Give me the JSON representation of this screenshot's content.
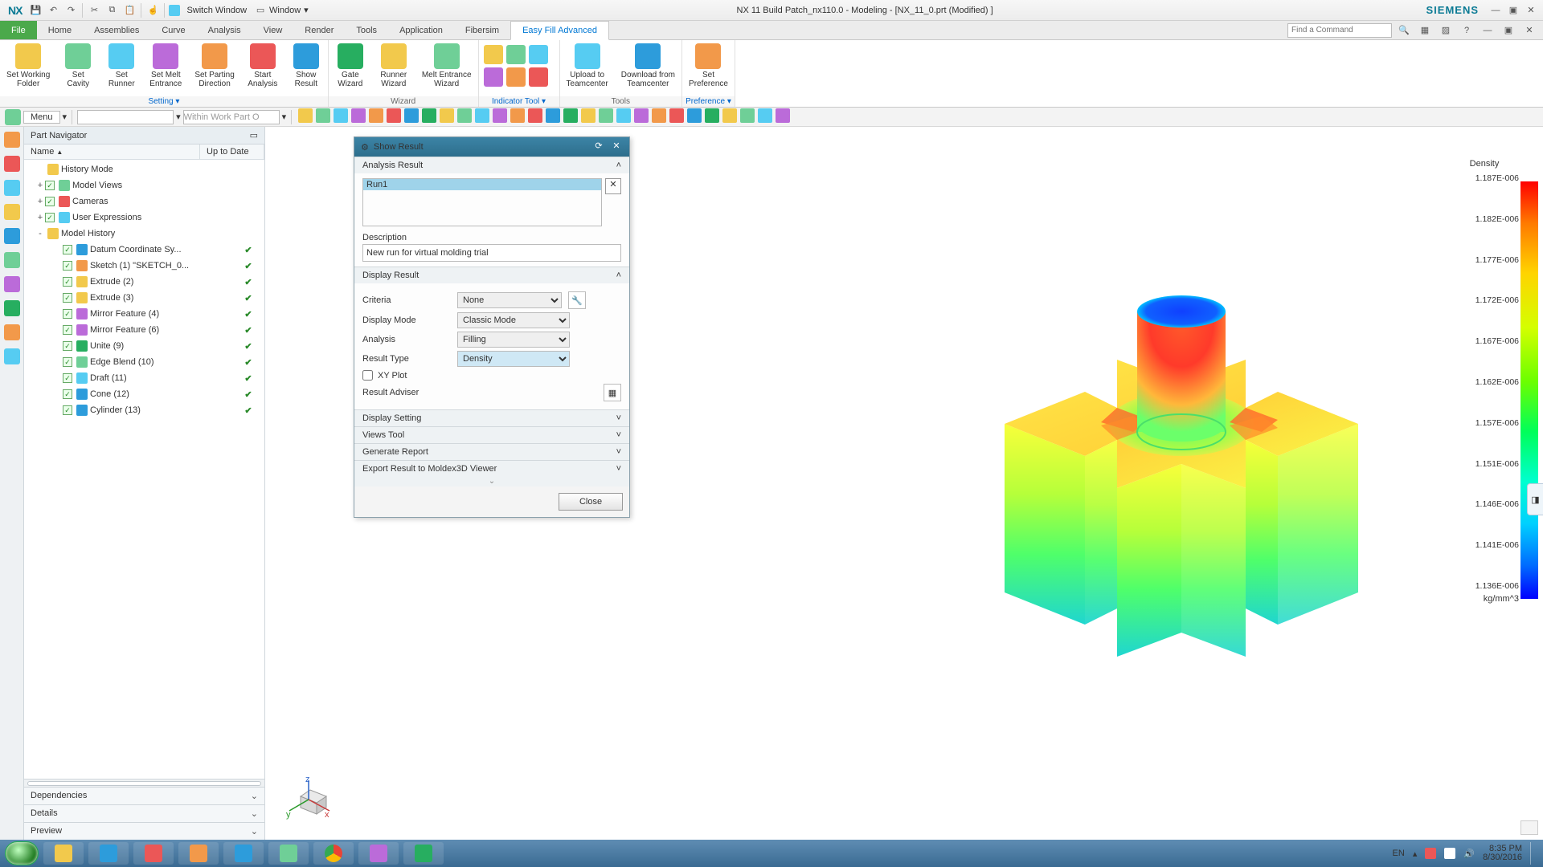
{
  "app": {
    "logo": "NX",
    "switch_window": "Switch Window",
    "window_menu": "Window",
    "title": "NX 11  Build Patch_nx110.0 - Modeling - [NX_11_0.prt (Modified) ]",
    "brand": "SIEMENS",
    "find_placeholder": "Find a Command"
  },
  "tabs": [
    "File",
    "Home",
    "Assemblies",
    "Curve",
    "Analysis",
    "View",
    "Render",
    "Tools",
    "Application",
    "Fibersim",
    "Easy Fill Advanced"
  ],
  "active_tab": 10,
  "ribbon": {
    "groups": [
      {
        "label": "Setting",
        "link": true,
        "buttons": [
          {
            "t1": "Set Working",
            "t2": "Folder",
            "c": "c1"
          },
          {
            "t1": "Set",
            "t2": "Cavity",
            "c": "c2"
          },
          {
            "t1": "Set",
            "t2": "Runner",
            "c": "c3"
          },
          {
            "t1": "Set Melt",
            "t2": "Entrance",
            "c": "c4"
          },
          {
            "t1": "Set Parting",
            "t2": "Direction",
            "c": "c5"
          },
          {
            "t1": "Start",
            "t2": "Analysis",
            "c": "c6"
          },
          {
            "t1": "Show",
            "t2": "Result",
            "c": "c7"
          }
        ]
      },
      {
        "label": "Wizard",
        "buttons": [
          {
            "t1": "Gate",
            "t2": "Wizard",
            "c": "c8"
          },
          {
            "t1": "Runner",
            "t2": "Wizard",
            "c": "c1"
          },
          {
            "t1": "Melt Entrance",
            "t2": "Wizard",
            "c": "c2"
          }
        ]
      },
      {
        "label": "Indicator Tool",
        "link": true,
        "small": true
      },
      {
        "label": "Tools",
        "buttons": [
          {
            "t1": "Upload to",
            "t2": "Teamcenter",
            "c": "c3"
          },
          {
            "t1": "Download from",
            "t2": "Teamcenter",
            "c": "c7"
          }
        ]
      },
      {
        "label": "Preference",
        "link": true,
        "buttons": [
          {
            "t1": "Set",
            "t2": "Preference",
            "c": "c5"
          }
        ]
      }
    ]
  },
  "menu_label": "Menu",
  "within": "Within Work Part O",
  "navigator": {
    "title": "Part Navigator",
    "cols": {
      "name": "Name",
      "upd": "Up to Date"
    },
    "items": [
      {
        "d": 0,
        "exp": "",
        "chk": false,
        "lbl": "History Mode",
        "ic": "c1"
      },
      {
        "d": 0,
        "exp": "+",
        "chk": true,
        "lbl": "Model Views",
        "ic": "c2"
      },
      {
        "d": 0,
        "exp": "+",
        "chk": true,
        "lbl": "Cameras",
        "ic": "c6"
      },
      {
        "d": 0,
        "exp": "+",
        "chk": true,
        "lbl": "User Expressions",
        "ic": "c3"
      },
      {
        "d": 0,
        "exp": "-",
        "chk": false,
        "lbl": "Model History",
        "ic": "c1"
      },
      {
        "d": 1,
        "chk": true,
        "lbl": "Datum Coordinate Sy...",
        "upd": "✔",
        "ic": "c7"
      },
      {
        "d": 1,
        "chk": true,
        "lbl": "Sketch (1) \"SKETCH_0...",
        "upd": "✔",
        "ic": "c5"
      },
      {
        "d": 1,
        "chk": true,
        "lbl": "Extrude (2)",
        "upd": "✔",
        "ic": "c1"
      },
      {
        "d": 1,
        "chk": true,
        "lbl": "Extrude (3)",
        "upd": "✔",
        "ic": "c1"
      },
      {
        "d": 1,
        "chk": true,
        "lbl": "Mirror Feature (4)",
        "upd": "✔",
        "ic": "c4"
      },
      {
        "d": 1,
        "chk": true,
        "lbl": "Mirror Feature (6)",
        "upd": "✔",
        "ic": "c4"
      },
      {
        "d": 1,
        "chk": true,
        "lbl": "Unite (9)",
        "upd": "✔",
        "ic": "c8"
      },
      {
        "d": 1,
        "chk": true,
        "lbl": "Edge Blend (10)",
        "upd": "✔",
        "ic": "c2"
      },
      {
        "d": 1,
        "chk": true,
        "lbl": "Draft (11)",
        "upd": "✔",
        "ic": "c3"
      },
      {
        "d": 1,
        "chk": true,
        "lbl": "Cone (12)",
        "upd": "✔",
        "ic": "c7"
      },
      {
        "d": 1,
        "chk": true,
        "lbl": "Cylinder (13)",
        "upd": "✔",
        "ic": "c7"
      }
    ],
    "sections": [
      "Dependencies",
      "Details",
      "Preview"
    ]
  },
  "dialog": {
    "title": "Show Result",
    "sec1": "Analysis Result",
    "run": "Run1",
    "desc_label": "Description",
    "desc": "New run for virtual molding trial",
    "sec2": "Display Result",
    "criteria_label": "Criteria",
    "criteria": "None",
    "dispmode_label": "Display Mode",
    "dispmode": "Classic Mode",
    "analysis_label": "Analysis",
    "analysis": "Filling",
    "restype_label": "Result Type",
    "restype": "Density",
    "xy": "XY Plot",
    "adviser": "Result Adviser",
    "collapsed": [
      "Display Setting",
      "Views Tool",
      "Generate Report",
      "Export Result to Moldex3D Viewer"
    ],
    "close": "Close"
  },
  "legend": {
    "title": "Density",
    "unit": "kg/mm^3",
    "ticks": [
      "1.187E-006",
      "1.182E-006",
      "1.177E-006",
      "1.172E-006",
      "1.167E-006",
      "1.162E-006",
      "1.157E-006",
      "1.151E-006",
      "1.146E-006",
      "1.141E-006",
      "1.136E-006"
    ]
  },
  "taskbar": {
    "lang": "EN",
    "time": "8:35 PM",
    "date": "8/30/2016"
  },
  "chart_data": {
    "type": "heatmap",
    "title": "Density",
    "unit": "kg/mm^3",
    "range_min": 1.136e-06,
    "range_max": 1.187e-06,
    "ticks": [
      1.187e-06,
      1.182e-06,
      1.177e-06,
      1.172e-06,
      1.167e-06,
      1.162e-06,
      1.157e-06,
      1.151e-06,
      1.146e-06,
      1.141e-06,
      1.136e-06
    ],
    "colormap": "jet"
  }
}
